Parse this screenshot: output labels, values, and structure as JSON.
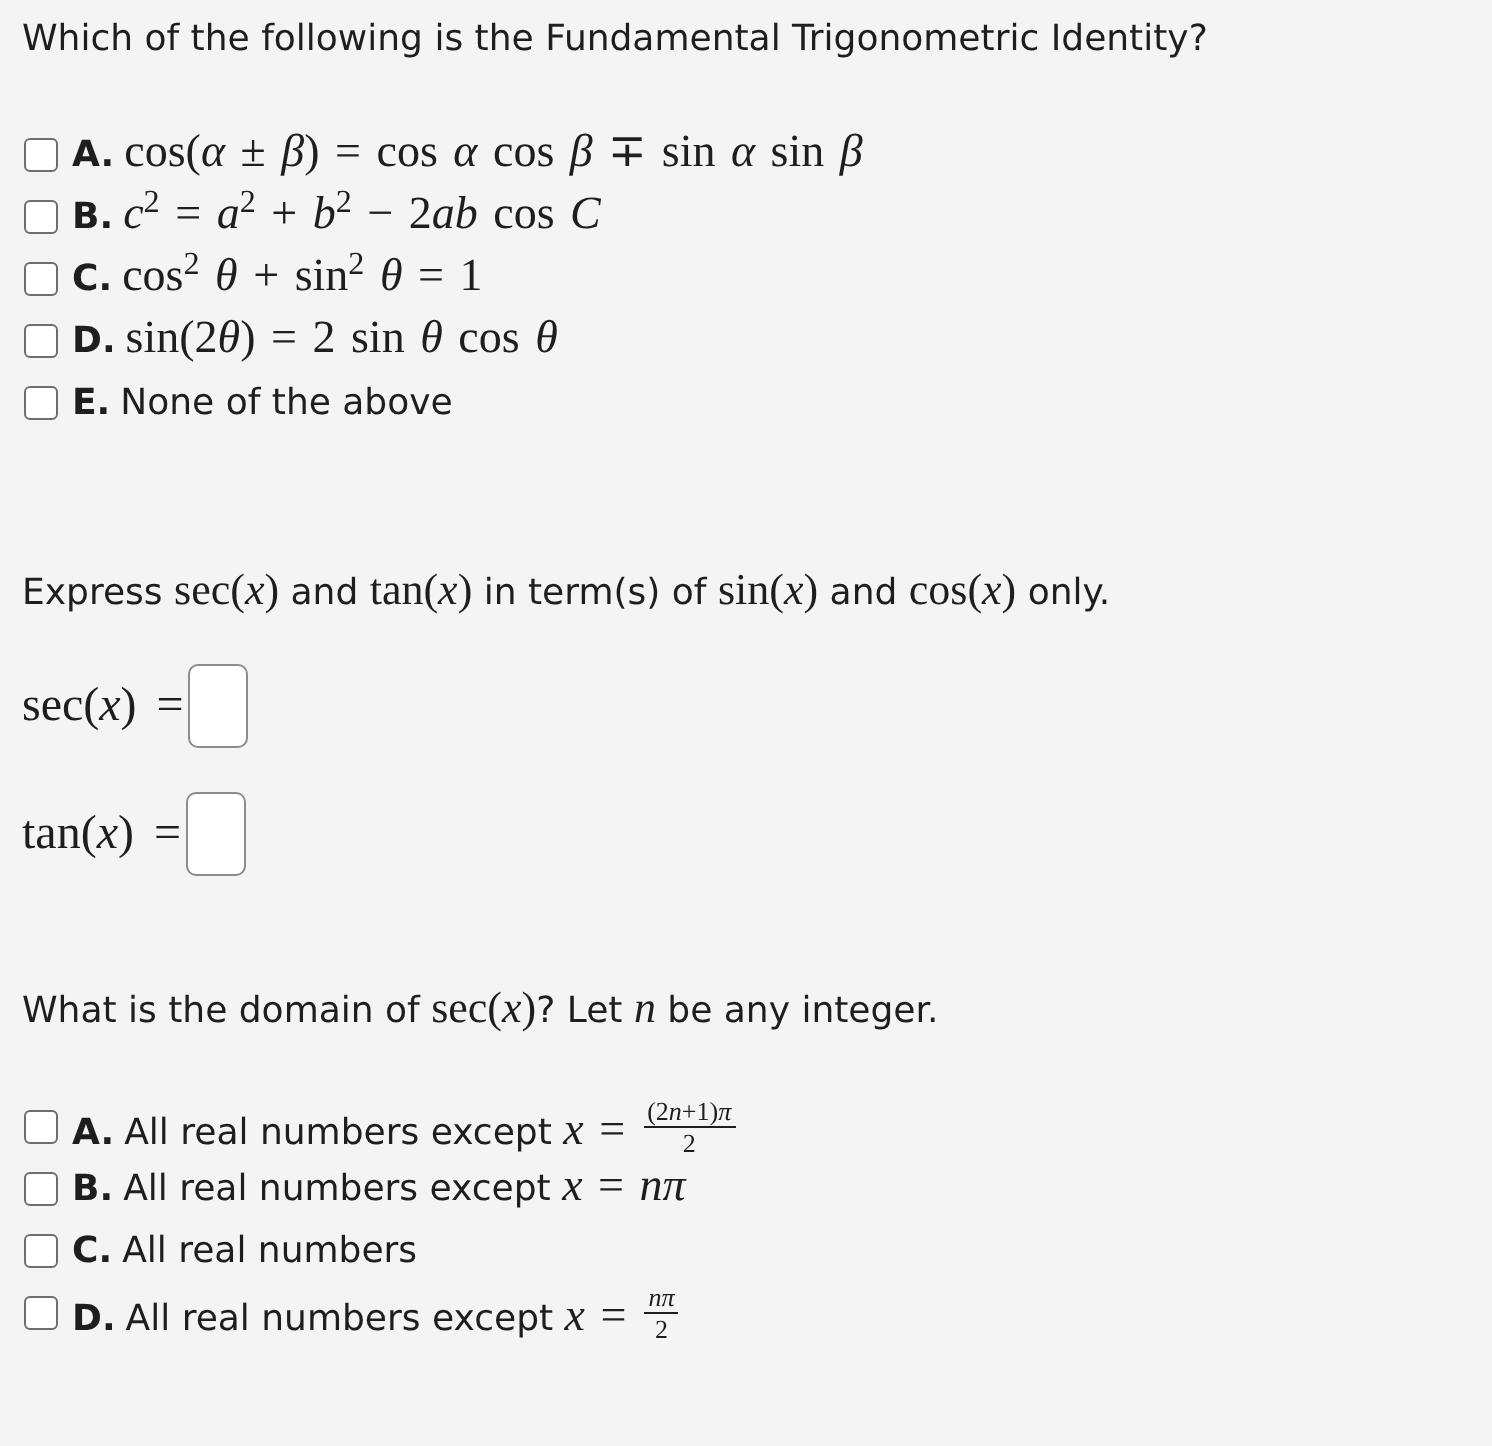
{
  "questions": [
    {
      "kind": "choice",
      "prompt": [
        {
          "kind": "text",
          "text": "Which of the following is the Fundamental Trigonometric Identity?"
        }
      ],
      "options": [
        {
          "letter": "A.",
          "checked": false,
          "segments": [
            {
              "kind": "math",
              "text": "cos(*α* ± *β*) = cos *α* cos *β* ∓ sin *α* sin *β*"
            }
          ]
        },
        {
          "letter": "B.",
          "checked": false,
          "segments": [
            {
              "kind": "math",
              "text": "*c*$^{2}$ = *a*$^{2}$ + *b*$^{2}$ − 2"
            },
            {
              "kind": "math",
              "text": "*ab* cos *C*"
            }
          ]
        },
        {
          "letter": "C.",
          "checked": false,
          "segments": [
            {
              "kind": "math",
              "text": "cos$^{2}$ *θ* + sin$^{2}$ *θ* = 1"
            }
          ]
        },
        {
          "letter": "D.",
          "checked": false,
          "segments": [
            {
              "kind": "math",
              "text": "sin(2"
            },
            {
              "kind": "math",
              "text": "*θ*) = 2 sin *θ* cos *θ*"
            }
          ]
        },
        {
          "letter": "E.",
          "checked": false,
          "segments": [
            {
              "kind": "text",
              "text": "None of the above"
            }
          ]
        }
      ]
    },
    {
      "kind": "fill",
      "prompt": [
        {
          "kind": "text",
          "text": "Express "
        },
        {
          "kind": "math",
          "text": "sec(*x*)"
        },
        {
          "kind": "text",
          "text": " and "
        },
        {
          "kind": "math",
          "text": "tan(*x*)"
        },
        {
          "kind": "text",
          "text": " in term(s) of "
        },
        {
          "kind": "math",
          "text": "sin(*x*)"
        },
        {
          "kind": "text",
          "text": " and "
        },
        {
          "kind": "math",
          "text": "cos(*x*)"
        },
        {
          "kind": "text",
          "text": " only."
        }
      ],
      "fields": [
        {
          "label": "sec(*x*) ="
        },
        {
          "label": "tan(*x*) ="
        }
      ]
    },
    {
      "kind": "choice",
      "prompt": [
        {
          "kind": "text",
          "text": "What is the domain of "
        },
        {
          "kind": "math",
          "text": "sec(*x*)"
        },
        {
          "kind": "text",
          "text": "? Let "
        },
        {
          "kind": "math",
          "text": "*n*"
        },
        {
          "kind": "text",
          "text": " be any integer."
        }
      ],
      "options": [
        {
          "letter": "A.",
          "checked": false,
          "segments": [
            {
              "kind": "text",
              "text": "All real numbers except "
            },
            {
              "kind": "math",
              "text": "*x* ="
            },
            {
              "kind": "frac",
              "numerator": [
                "(2",
                "*n*+1)*π*"
              ],
              "denominator": [
                "2"
              ]
            }
          ]
        },
        {
          "letter": "B.",
          "checked": false,
          "segments": [
            {
              "kind": "text",
              "text": "All real numbers except "
            },
            {
              "kind": "math",
              "text": "*x* = *nπ*"
            }
          ]
        },
        {
          "letter": "C.",
          "checked": false,
          "segments": [
            {
              "kind": "text",
              "text": "All real numbers"
            }
          ]
        },
        {
          "letter": "D.",
          "checked": false,
          "segments": [
            {
              "kind": "text",
              "text": "All real numbers except "
            },
            {
              "kind": "math",
              "text": "*x* ="
            },
            {
              "kind": "frac",
              "numerator": [
                "*nπ*"
              ],
              "denominator": [
                "2"
              ]
            }
          ]
        }
      ]
    }
  ]
}
